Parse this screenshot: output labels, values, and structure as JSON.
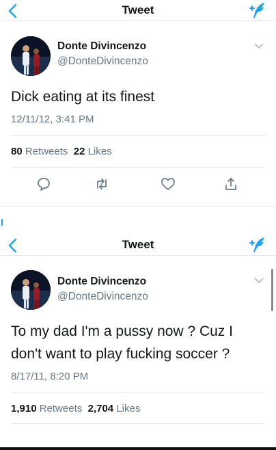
{
  "tweets": [
    {
      "nav_title": "Tweet",
      "author_name": "Donte Divincenzo",
      "author_handle": "@DonteDivincenzo",
      "text_lines": [
        "Dick eating at its finest"
      ],
      "timestamp": "12/11/12, 3:41 PM",
      "retweets_count": "80",
      "retweets_label": "Retweets",
      "likes_count": "22",
      "likes_label": "Likes"
    },
    {
      "nav_title": "Tweet",
      "author_name": "Donte Divincenzo",
      "author_handle": "@DonteDivincenzo",
      "text_lines": [
        "To my dad I'm a pussy now ? Cuz I",
        "don't want to play fucking soccer ?"
      ],
      "timestamp": "8/17/11, 8:20 PM",
      "retweets_count": "1,910",
      "retweets_label": "Retweets",
      "likes_count": "2,704",
      "likes_label": "Likes"
    }
  ],
  "icons": {
    "back": "chevron-left-icon",
    "compose": "compose-tweet-icon",
    "caret": "chevron-down-icon",
    "reply": "reply-icon",
    "retweet": "retweet-icon",
    "like": "heart-icon",
    "share": "share-icon"
  },
  "colors": {
    "accent": "#1da1f2",
    "secondary_text": "#657786",
    "primary_text": "#14171a",
    "divider": "#e1e8ed"
  }
}
